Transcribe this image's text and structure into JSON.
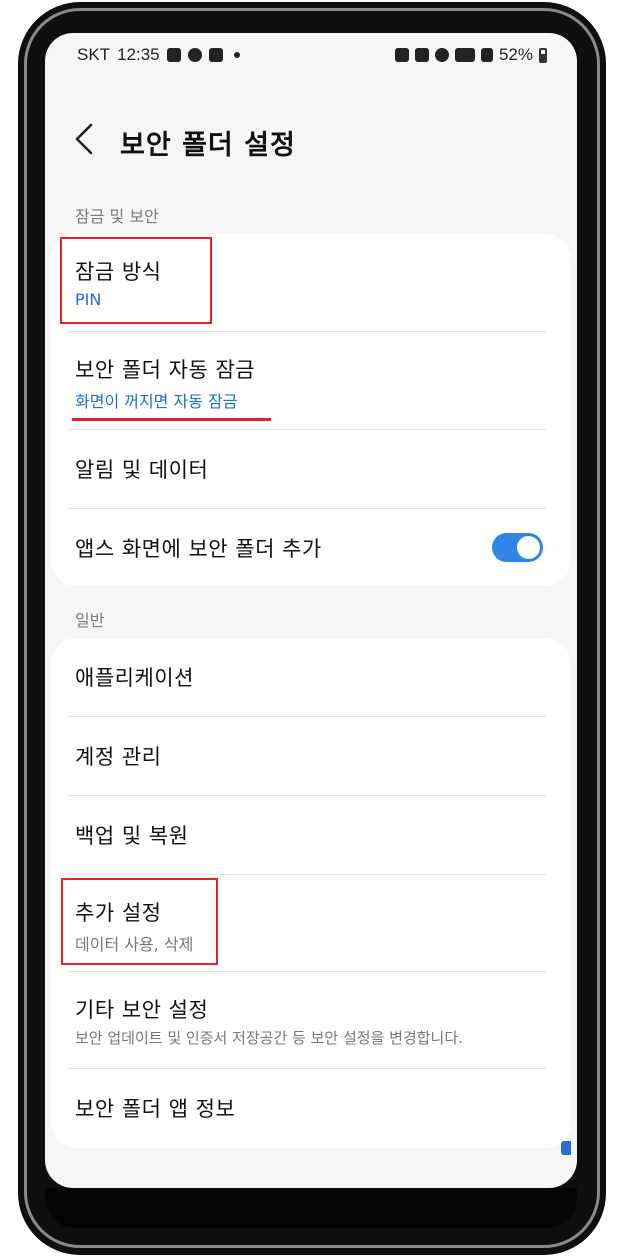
{
  "status_bar": {
    "carrier": "SKT",
    "time": "12:35",
    "battery_percent": "52%"
  },
  "header": {
    "back_icon": "chevron-left-icon",
    "title": "보안 폴더 설정"
  },
  "sections": {
    "lock_security": {
      "label": "잠금 및 보안",
      "items": [
        {
          "title": "잠금 방식",
          "subtitle": "PIN"
        },
        {
          "title": "보안 폴더 자동 잠금",
          "subtitle": "화면이 꺼지면 자동 잠금"
        },
        {
          "title": "알림 및 데이터"
        },
        {
          "title": "앱스 화면에 보안 폴더 추가",
          "toggle_on": true
        }
      ]
    },
    "general": {
      "label": "일반",
      "items": [
        {
          "title": "애플리케이션"
        },
        {
          "title": "계정 관리"
        },
        {
          "title": "백업 및 복원"
        },
        {
          "title": "추가 설정",
          "subtitle": "데이터 사용, 삭제"
        },
        {
          "title": "기타 보안 설정",
          "subtitle": "보안 업데이트 및 인증서 저장공간 등 보안 설정을 변경합니다."
        },
        {
          "title": "보안 폴더 앱 정보"
        }
      ]
    }
  },
  "colors": {
    "accent_blue": "#1a6fd1",
    "toggle_on": "#2f86e6",
    "annotation_red": "#e5212b",
    "background": "#f6f6f6"
  }
}
